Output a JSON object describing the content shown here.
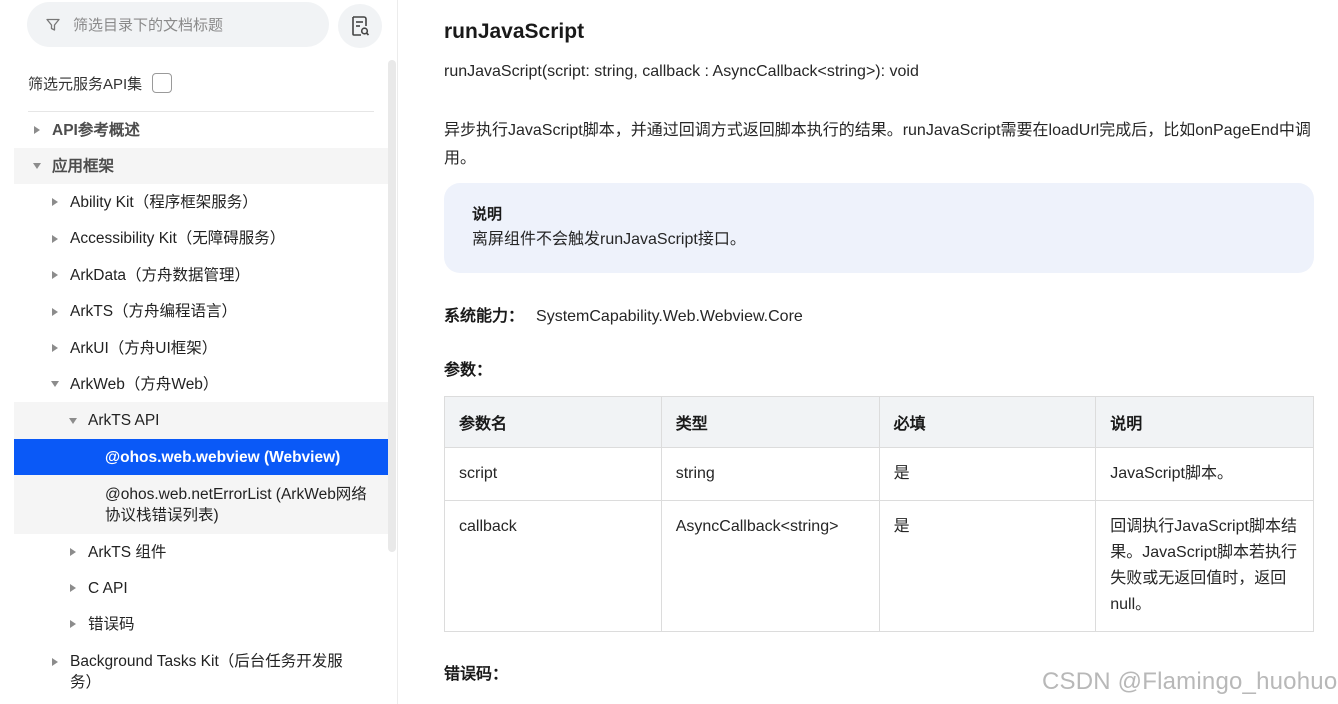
{
  "sidebar": {
    "filter_placeholder": "筛选目录下的文档标题",
    "service_filter_label": "筛选元服务API集",
    "tree": [
      {
        "label": "API参考概述",
        "state": "collapsed",
        "level": 0,
        "bold": true
      },
      {
        "label": "应用框架",
        "state": "expanded",
        "level": 0,
        "bold": true
      },
      {
        "label": "Ability Kit（程序框架服务）",
        "state": "collapsed",
        "level": 1
      },
      {
        "label": "Accessibility Kit（无障碍服务）",
        "state": "collapsed",
        "level": 1
      },
      {
        "label": "ArkData（方舟数据管理）",
        "state": "collapsed",
        "level": 1
      },
      {
        "label": "ArkTS（方舟编程语言）",
        "state": "collapsed",
        "level": 1
      },
      {
        "label": "ArkUI（方舟UI框架）",
        "state": "collapsed",
        "level": 1
      },
      {
        "label": "ArkWeb（方舟Web）",
        "state": "expanded",
        "level": 1
      },
      {
        "label": "ArkTS API",
        "state": "expanded",
        "level": 2
      },
      {
        "label": "@ohos.web.webview (Webview)",
        "state": "leaf",
        "level": 3,
        "selected": true
      },
      {
        "label": "@ohos.web.netErrorList (ArkWeb网络协议栈错误列表)",
        "state": "leaf",
        "level": 3
      },
      {
        "label": "ArkTS 组件",
        "state": "collapsed",
        "level": 2
      },
      {
        "label": "C API",
        "state": "collapsed",
        "level": 2
      },
      {
        "label": "错误码",
        "state": "collapsed",
        "level": 2
      },
      {
        "label": "Background Tasks Kit（后台任务开发服务）",
        "state": "collapsed",
        "level": 1
      }
    ]
  },
  "main": {
    "title": "runJavaScript",
    "signature": "runJavaScript(script: string, callback : AsyncCallback<string>): void",
    "description": "异步执行JavaScript脚本，并通过回调方式返回脚本执行的结果。runJavaScript需要在loadUrl完成后，比如onPageEnd中调用。",
    "note": {
      "title": "说明",
      "body": "离屏组件不会触发runJavaScript接口。"
    },
    "syscap": {
      "label": "系统能力：",
      "value": "SystemCapability.Web.Webview.Core"
    },
    "params_heading": "参数：",
    "params_table": {
      "headers": [
        "参数名",
        "类型",
        "必填",
        "说明"
      ],
      "rows": [
        [
          "script",
          "string",
          "是",
          "JavaScript脚本。"
        ],
        [
          "callback",
          "AsyncCallback<string>",
          "是",
          "回调执行JavaScript脚本结果。JavaScript脚本若执行失败或无返回值时，返回null。"
        ]
      ]
    },
    "errors_heading": "错误码："
  },
  "watermark": "CSDN @Flamingo_huohuo",
  "colors": {
    "selected_bg": "#0a59f7",
    "note_bg": "#eef2fb",
    "table_header_bg": "#f1f3f5"
  }
}
